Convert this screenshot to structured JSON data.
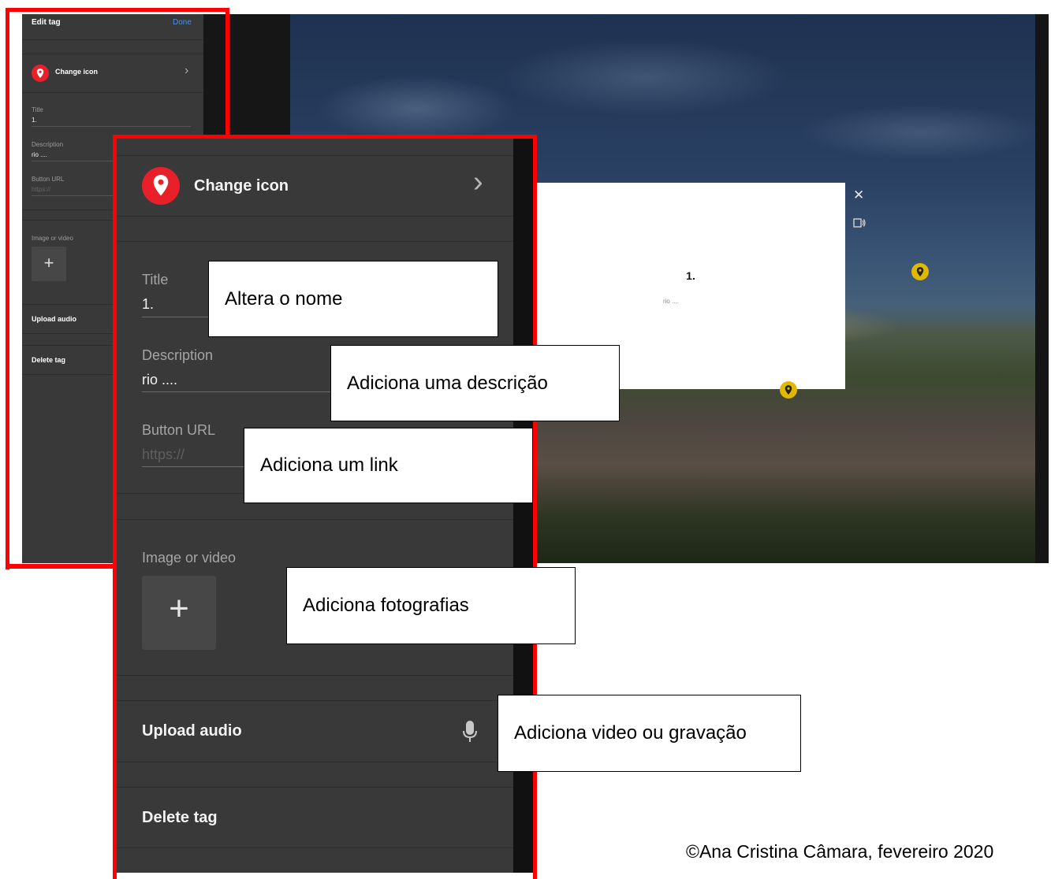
{
  "small_panel": {
    "header_title": "Edit tag",
    "done_label": "Done",
    "change_icon_label": "Change icon",
    "title_label": "Title",
    "title_value": "1.",
    "description_label": "Description",
    "description_value": "rio ....",
    "button_url_label": "Button URL",
    "button_url_placeholder": "https://",
    "image_video_label": "Image or video",
    "upload_audio_label": "Upload audio",
    "delete_tag_label": "Delete tag"
  },
  "popup": {
    "title": "1.",
    "description": "rio ...."
  },
  "zoomed_panel": {
    "change_icon_label": "Change icon",
    "title_label": "Title",
    "title_value": "1.",
    "description_label": "Description",
    "description_value": "rio ....",
    "button_url_label": "Button URL",
    "button_url_placeholder": "https://",
    "image_video_label": "Image or video",
    "upload_audio_label": "Upload audio",
    "delete_tag_label": "Delete tag"
  },
  "callouts": {
    "title": "Altera o nome",
    "description": "Adiciona uma descrição",
    "link": "Adiciona um link",
    "photos": "Adiciona fotografias",
    "audio": "Adiciona video ou gravação"
  },
  "credit": "©Ana Cristina Câmara, fevereiro 2020",
  "colors": {
    "accent_red": "#ff0000",
    "done_blue": "#4a90e2",
    "pin_red": "#e8202a",
    "pin_yellow": "#e0b800",
    "panel_bg": "#393939"
  },
  "icons": {
    "pin": "map-pin-icon",
    "chevron": "chevron-right-icon",
    "plus": "plus-icon",
    "mic": "microphone-icon",
    "close": "close-icon",
    "audio_desc": "audio-description-icon"
  }
}
